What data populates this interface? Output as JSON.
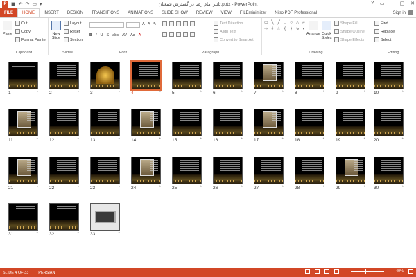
{
  "window": {
    "title": "تاثیر امام رضا در گسترش شیعیان.pptx - PowerPoint",
    "app_logo": "P",
    "controls": [
      "?",
      "▭",
      "–",
      "▢",
      "✕"
    ]
  },
  "qat": [
    "undo-icon",
    "redo-icon",
    "start-icon",
    "customize-icon"
  ],
  "tabs": [
    "FILE",
    "HOME",
    "INSERT",
    "DESIGN",
    "TRANSITIONS",
    "ANIMATIONS",
    "SLIDE SHOW",
    "REVIEW",
    "VIEW",
    "FILEminimizer",
    "Nitro PDF Professional"
  ],
  "active_tab": "HOME",
  "account": {
    "label": "Sign in"
  },
  "ribbon": {
    "clipboard": {
      "label": "Clipboard",
      "paste": "Paste",
      "cut": "Cut",
      "copy": "Copy",
      "format_painter": "Format Painter"
    },
    "slides": {
      "label": "Slides",
      "new_slide": "New Slide",
      "layout": "Layout",
      "reset": "Reset",
      "section": "Section"
    },
    "font": {
      "label": "Font",
      "buttons": [
        "B",
        "I",
        "U",
        "S",
        "abc",
        "AV",
        "Aa",
        "A"
      ]
    },
    "paragraph": {
      "label": "Paragraph",
      "text_direction": "Text Direction",
      "align_text": "Align Text",
      "convert_smartart": "Convert to SmartArt"
    },
    "drawing": {
      "label": "Drawing",
      "arrange": "Arrange",
      "quick_styles": "Quick Styles",
      "shape_fill": "Shape Fill",
      "shape_outline": "Shape Outline",
      "shape_effects": "Shape Effects"
    },
    "editing": {
      "label": "Editing",
      "find": "Find",
      "replace": "Replace",
      "select": "Select"
    }
  },
  "slides": [
    {
      "n": "1",
      "kind": "title"
    },
    {
      "n": "2",
      "kind": "text"
    },
    {
      "n": "3",
      "kind": "dome"
    },
    {
      "n": "4",
      "kind": "text",
      "selected": true
    },
    {
      "n": "5",
      "kind": "text"
    },
    {
      "n": "6",
      "kind": "text"
    },
    {
      "n": "7",
      "kind": "photo"
    },
    {
      "n": "8",
      "kind": "text"
    },
    {
      "n": "9",
      "kind": "text"
    },
    {
      "n": "10",
      "kind": "text"
    },
    {
      "n": "11",
      "kind": "photo"
    },
    {
      "n": "12",
      "kind": "text"
    },
    {
      "n": "13",
      "kind": "text"
    },
    {
      "n": "14",
      "kind": "photo"
    },
    {
      "n": "15",
      "kind": "text"
    },
    {
      "n": "16",
      "kind": "text"
    },
    {
      "n": "17",
      "kind": "photo"
    },
    {
      "n": "18",
      "kind": "text"
    },
    {
      "n": "19",
      "kind": "text"
    },
    {
      "n": "20",
      "kind": "text"
    },
    {
      "n": "21",
      "kind": "photo"
    },
    {
      "n": "22",
      "kind": "text"
    },
    {
      "n": "23",
      "kind": "text"
    },
    {
      "n": "24",
      "kind": "photo"
    },
    {
      "n": "25",
      "kind": "text"
    },
    {
      "n": "26",
      "kind": "text"
    },
    {
      "n": "27",
      "kind": "text"
    },
    {
      "n": "28",
      "kind": "text"
    },
    {
      "n": "29",
      "kind": "photo"
    },
    {
      "n": "30",
      "kind": "text"
    },
    {
      "n": "31",
      "kind": "text"
    },
    {
      "n": "32",
      "kind": "text"
    },
    {
      "n": "33",
      "kind": "laptop"
    }
  ],
  "slide_star": "*",
  "status": {
    "slide_info": "SLIDE 4 OF 33",
    "language": "PERSIAN",
    "zoom": "40%",
    "zoom_minus": "–",
    "zoom_plus": "+"
  },
  "colors": {
    "accent": "#d24726",
    "selection": "#e06a3a"
  }
}
